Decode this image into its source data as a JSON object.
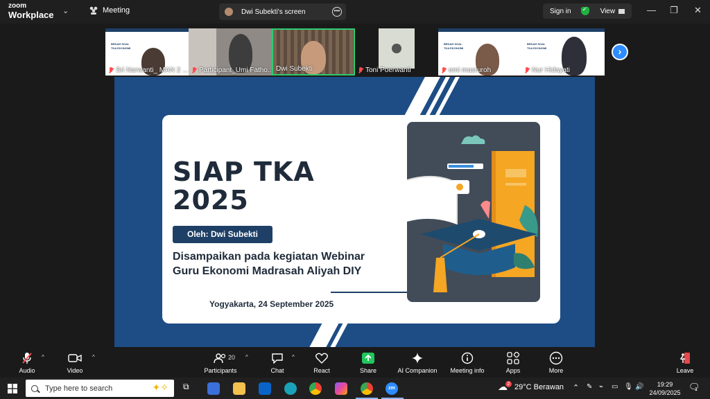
{
  "titlebar": {
    "brand_top": "zoom",
    "brand_bottom": "Workplace",
    "meeting_label": "Meeting",
    "screen_share_label": "Dwi Subekti's screen",
    "sign_in": "Sign in",
    "view": "View"
  },
  "participants": [
    {
      "name": "Sri Narwanti_ MAN 2 ..."
    },
    {
      "name": "Participant_Umi Fatho..."
    },
    {
      "name": "Dwi Subekti"
    },
    {
      "name": "Toni Poerwanti"
    },
    {
      "name": "emi masruroh"
    },
    {
      "name": "Nur Hidayati"
    }
  ],
  "slide_thumb_title": "BEDAH SOAL TKA EKONOMI",
  "slide": {
    "title_line1": "SIAP TKA",
    "title_line2": "2025",
    "presenter": "Oleh: Dwi Subekti",
    "subtitle_line1": "Disampaikan pada kegiatan Webinar",
    "subtitle_line2": "Guru Ekonomi Madrasah Aliyah DIY",
    "place_date": "Yogyakarta, 24 September 2025"
  },
  "toolbar": {
    "audio": "Audio",
    "video": "Video",
    "participants": "Participants",
    "participant_count": "20",
    "chat": "Chat",
    "react": "React",
    "share": "Share",
    "ai_companion": "AI Companion",
    "meeting_info": "Meeting info",
    "apps": "Apps",
    "more": "More",
    "leave": "Leave"
  },
  "taskbar": {
    "search_placeholder": "Type here to search",
    "weather": "29°C  Berawan",
    "time": "19:29",
    "date": "24/09/2025",
    "notification_count": "1",
    "weather_badge": "2"
  },
  "colors": {
    "slide_blue": "#1d4d84",
    "navy": "#1e3f66",
    "accent_blue": "#2d8cff",
    "share_green": "#22c55e",
    "leave_red": "#e5484d"
  }
}
